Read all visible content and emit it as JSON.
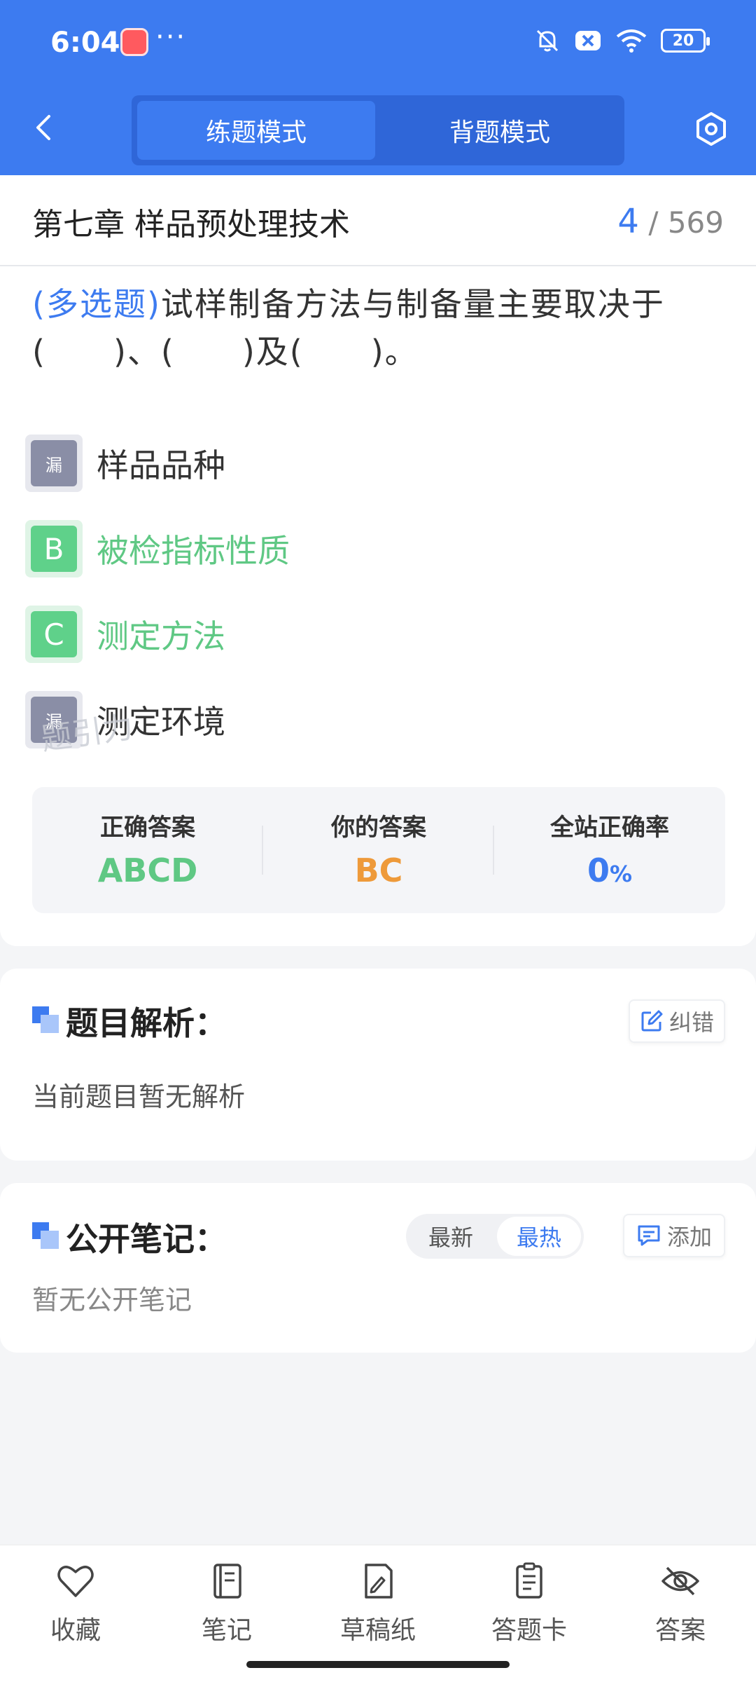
{
  "status_bar": {
    "time": "6:04",
    "dots": "···",
    "battery": "20"
  },
  "header": {
    "modes": [
      "练题模式",
      "背题模式"
    ],
    "active_mode": "练题模式",
    "accent": "#3d7bf0"
  },
  "chapter": {
    "title": "第七章 样品预处理技术",
    "current": "4",
    "total": "569",
    "sep": "/"
  },
  "question": {
    "type": "(多选题)",
    "text": "试样制备方法与制备量主要取决于(　　)、(　　)及(　　)。"
  },
  "options": [
    {
      "badge": "漏",
      "text": "样品品种",
      "state": "missed"
    },
    {
      "badge": "B",
      "text": "被检指标性质",
      "state": "correct"
    },
    {
      "badge": "C",
      "text": "测定方法",
      "state": "correct"
    },
    {
      "badge": "漏",
      "text": "测定环境",
      "state": "missed"
    }
  ],
  "stats": {
    "correct_label": "正确答案",
    "correct_value": "ABCD",
    "yours_label": "你的答案",
    "yours_value": "BC",
    "rate_label": "全站正确率",
    "rate_value": "0",
    "rate_unit": "%"
  },
  "watermark": "题引力",
  "analysis": {
    "title": "题目解析：",
    "correct_btn": "纠错",
    "empty": "当前题目暂无解析"
  },
  "notes": {
    "title": "公开笔记：",
    "sort_latest": "最新",
    "sort_hot": "最热",
    "add_btn": "添加",
    "empty": "暂无公开笔记"
  },
  "bottom_nav": [
    {
      "label": "收藏",
      "icon": "heart-icon"
    },
    {
      "label": "笔记",
      "icon": "notebook-icon"
    },
    {
      "label": "草稿纸",
      "icon": "draft-paper-icon"
    },
    {
      "label": "答题卡",
      "icon": "answer-card-icon"
    },
    {
      "label": "答案",
      "icon": "eye-off-icon"
    }
  ]
}
